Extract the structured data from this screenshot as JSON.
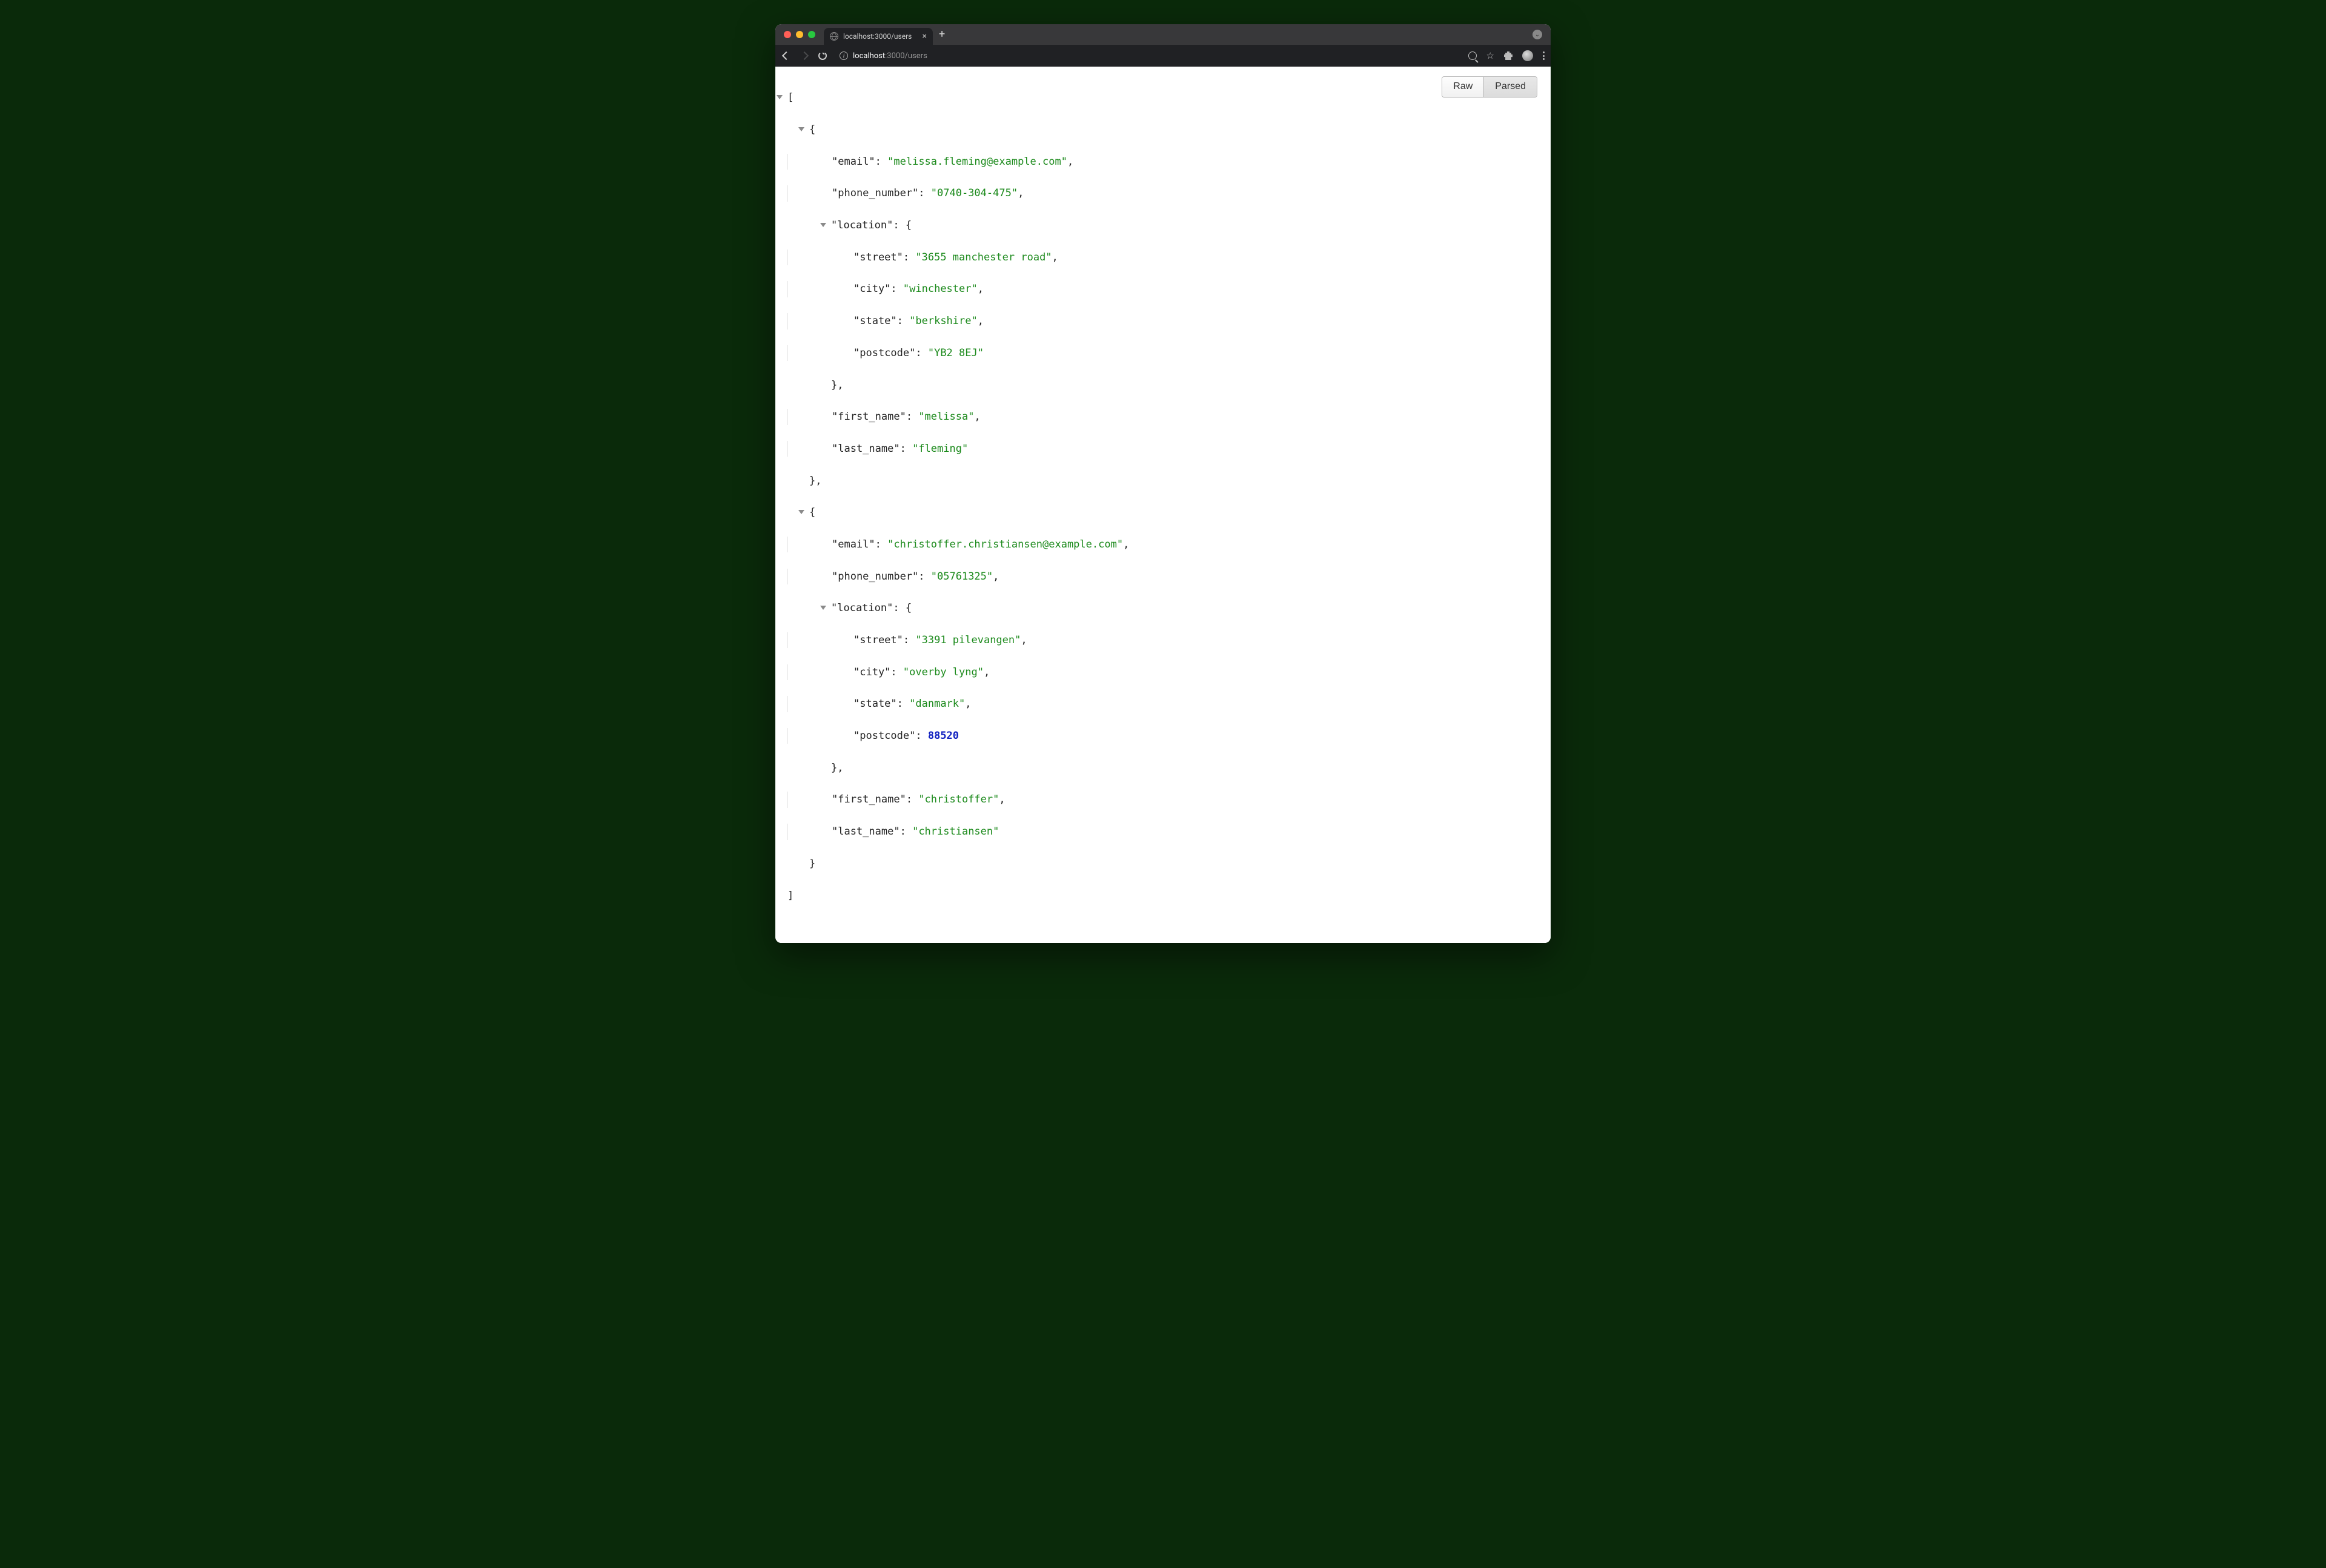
{
  "browser": {
    "tab_title": "localhost:3000/users",
    "address_host": "localhost",
    "address_port_path": ":3000/users",
    "toggle_raw": "Raw",
    "toggle_parsed": "Parsed"
  },
  "json_keys": {
    "email": "\"email\"",
    "phone_number": "\"phone_number\"",
    "location": "\"location\"",
    "street": "\"street\"",
    "city": "\"city\"",
    "state": "\"state\"",
    "postcode": "\"postcode\"",
    "first_name": "\"first_name\"",
    "last_name": "\"last_name\""
  },
  "users": [
    {
      "email": "\"melissa.fleming@example.com\"",
      "phone_number": "\"0740-304-475\"",
      "location": {
        "street": "\"3655 manchester road\"",
        "city": "\"winchester\"",
        "state": "\"berkshire\"",
        "postcode": "\"YB2 8EJ\"",
        "postcode_is_number": false
      },
      "first_name": "\"melissa\"",
      "last_name": "\"fleming\""
    },
    {
      "email": "\"christoffer.christiansen@example.com\"",
      "phone_number": "\"05761325\"",
      "location": {
        "street": "\"3391 pilevangen\"",
        "city": "\"overby lyng\"",
        "state": "\"danmark\"",
        "postcode": "88520",
        "postcode_is_number": true
      },
      "first_name": "\"christoffer\"",
      "last_name": "\"christiansen\""
    }
  ]
}
